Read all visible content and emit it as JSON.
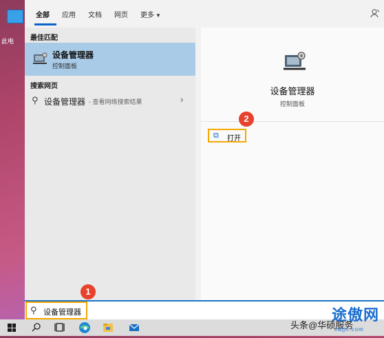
{
  "desktop": {
    "icon_label": "此电"
  },
  "tabs": [
    {
      "label": "全部",
      "active": true
    },
    {
      "label": "应用"
    },
    {
      "label": "文档"
    },
    {
      "label": "网页"
    },
    {
      "label": "更多"
    }
  ],
  "tabs_more_arrow": "▼",
  "best_match": {
    "header": "最佳匹配",
    "title": "设备管理器",
    "subtitle": "控制面板"
  },
  "web_search": {
    "header": "搜索网页",
    "query": "设备管理器",
    "hint": "- 查看网络搜索结果"
  },
  "detail": {
    "title": "设备管理器",
    "subtitle": "控制面板",
    "open_label": "打开"
  },
  "badges": {
    "one": "1",
    "two": "2"
  },
  "search_box": {
    "value": "设备管理器"
  },
  "watermark": {
    "text": "头条@华硕服务",
    "logo": "途傲网",
    "url": "xajjn.com"
  },
  "colors": {
    "accent": "#0a64c8",
    "highlight": "#f5a800",
    "badge": "#e8412c",
    "selected": "#a9cbe8"
  }
}
